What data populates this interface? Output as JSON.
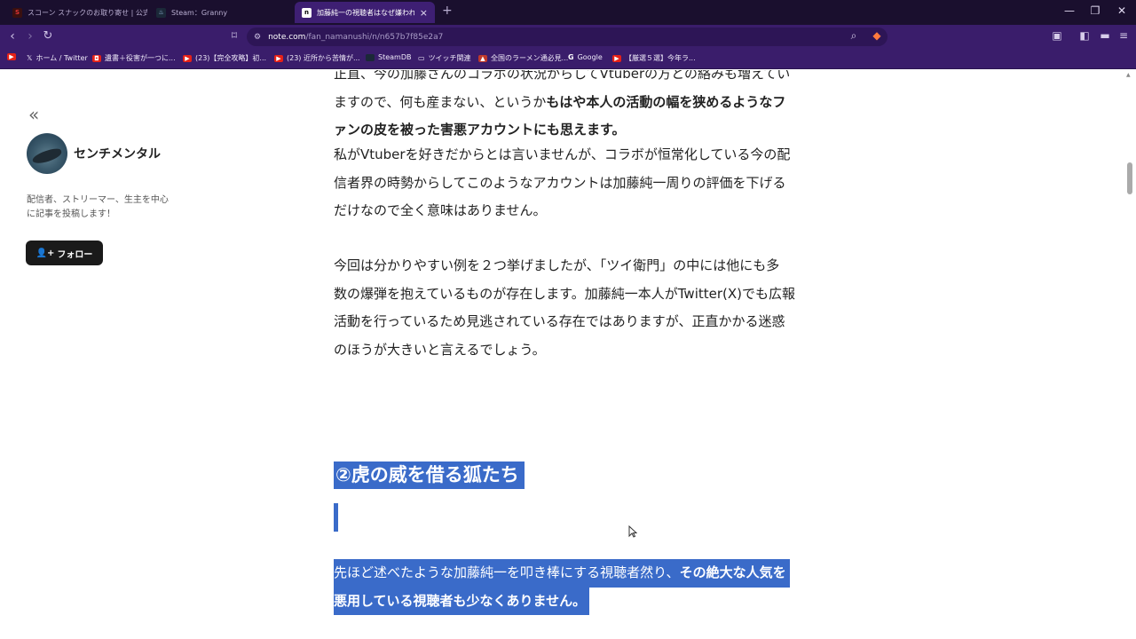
{
  "browser": {
    "tabs": [
      {
        "title": "スコーン スナックのお取り寄せ | 公式通販",
        "favicon": "S"
      },
      {
        "title": "Steam：Granny",
        "favicon": "♨"
      },
      {
        "title": "加藤純一の視聴者はなぜ嫌われて",
        "favicon": "n"
      }
    ],
    "new_tab": "+",
    "window_controls": {
      "minimize": "—",
      "restore": "❐",
      "close": "✕"
    },
    "url_host": "note.com",
    "url_path": "/fan_namanushi/n/n657b7f85e2a7",
    "bookmarks": [
      {
        "label": "",
        "color": "#e62117"
      },
      {
        "label": "ホーム / Twitter",
        "color": "#000000"
      },
      {
        "label": "遺書＋役害が一つに...",
        "color": "#e62117"
      },
      {
        "label": "(23)【完全攻略】初...",
        "color": "#e62117"
      },
      {
        "label": "(23) 近所から苦情が...",
        "color": "#e62117"
      },
      {
        "label": "SteamDB",
        "color": "#1b2838"
      },
      {
        "label": "ツイッチ関連",
        "color": "folder"
      },
      {
        "label": "全国のラーメン通必見...",
        "color": "#c0392b"
      },
      {
        "label": "Google",
        "color": "#4285f4"
      },
      {
        "label": "【厳選５選】今年ラ...",
        "color": "#e62117"
      }
    ]
  },
  "sidebar": {
    "collapse_icon": "«",
    "creator_name": "センチメンタル",
    "bio": "配信者、ストリーマー、生主を中心に記事を投稿します！",
    "follow_label": "フォロー"
  },
  "article": {
    "p1_line0": "正直、今の加藤さんのコラボの状況からしてVtuberの方との絡みも増えてい",
    "p1_line1_a": "ますので、何も産まない、というか",
    "p1_line1_b": "もはや本人の活動の幅を狭めるようなフ",
    "p1_line2": "ァンの皮を被った害悪アカウントにも思えます。",
    "p2_line0": "私がVtuberを好きだからとは言いませんが、コラボが恒常化している今の配",
    "p2_line1": "信者界の時勢からしてこのようなアカウントは加藤純一周りの評価を下げる",
    "p2_line2": "だけなので全く意味はありません。",
    "p3_line0": "今回は分かりやすい例を２つ挙げましたが、「ツイ衛門」の中には他にも多",
    "p3_line1": "数の爆弾を抱えているものが存在します。加藤純一本人がTwitter(X)でも広報",
    "p3_line2": "活動を行っているため見逃されている存在ではありますが、正直かかる迷惑",
    "p3_line3": "のほうが大きいと言えるでしょう。",
    "heading": "②虎の威を借る狐たち",
    "p4_line0_a": "先ほど述べたような加藤純一を叩き棒にする視聴者然り、",
    "p4_line0_b": "その絶大な人気を",
    "p4_line1": "悪用している視聴者も少なくありません。"
  },
  "colors": {
    "highlight": "#3a6bc9",
    "chrome": "#3a1d6b",
    "tabbar": "#1a0f2e"
  }
}
